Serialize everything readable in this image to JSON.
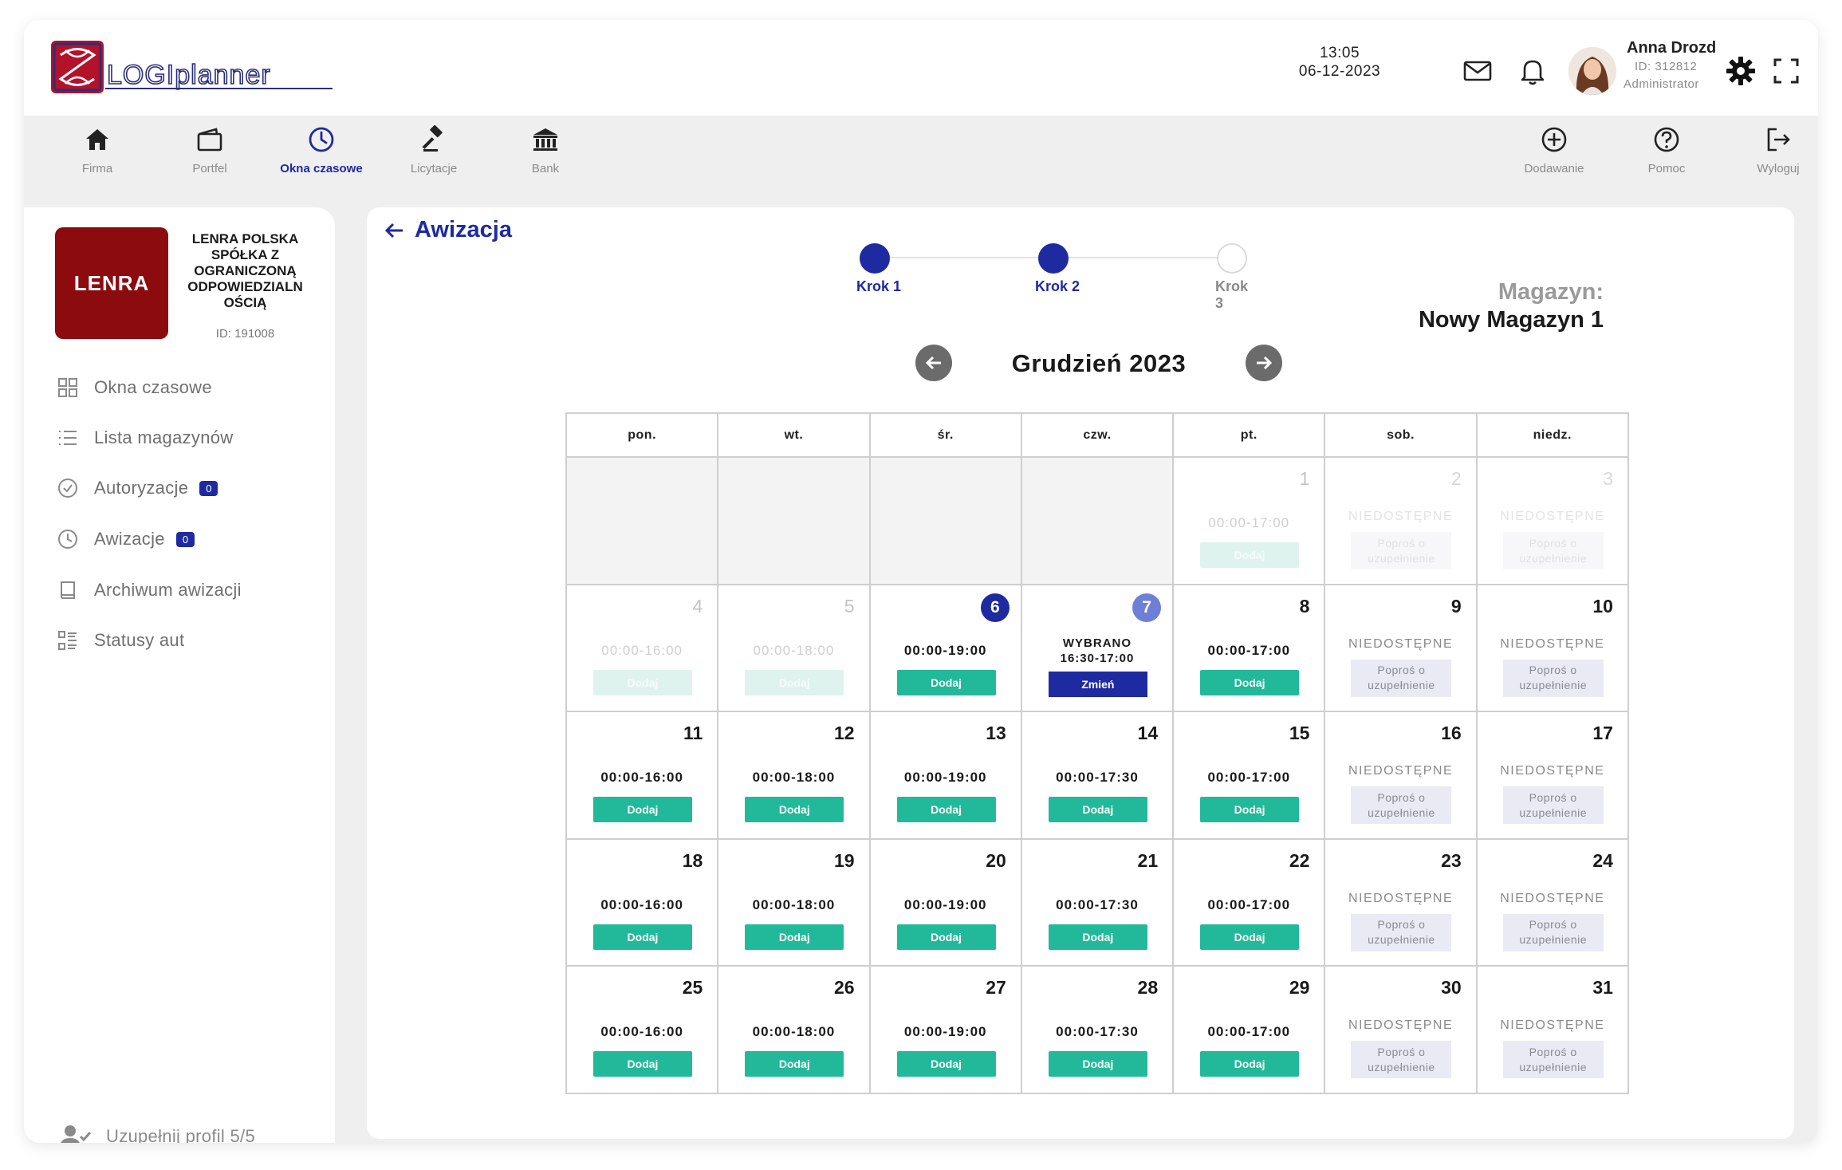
{
  "header": {
    "logo_text": "LOGIplanner",
    "time": "13:05",
    "date": "06-12-2023",
    "user": {
      "name": "Anna Drozd",
      "id": "ID: 312812",
      "role": "Administrator"
    }
  },
  "nav": {
    "left": [
      {
        "label": "Firma",
        "icon": "home-icon"
      },
      {
        "label": "Portfel",
        "icon": "wallet-icon"
      },
      {
        "label": "Okna czasowe",
        "icon": "clock-icon",
        "active": true
      },
      {
        "label": "Licytacje",
        "icon": "gavel-icon"
      },
      {
        "label": "Bank",
        "icon": "bank-icon"
      }
    ],
    "right": [
      {
        "label": "Dodawanie",
        "icon": "plus-circle-icon"
      },
      {
        "label": "Pomoc",
        "icon": "help-icon"
      },
      {
        "label": "Wyloguj",
        "icon": "logout-icon"
      }
    ]
  },
  "sidebar": {
    "company_logo_text": "LENRA",
    "company_name": "LENRA POLSKA SPÓŁKA Z OGRANICZONĄ ODPOWIEDZIALN OŚCIĄ",
    "company_id": "ID: 191008",
    "menu": [
      {
        "label": "Okna czasowe",
        "icon": "grid-icon"
      },
      {
        "label": "Lista magazynów",
        "icon": "list-icon"
      },
      {
        "label": "Autoryzacje",
        "icon": "check-circle-icon",
        "badge": "0"
      },
      {
        "label": "Awizacje",
        "icon": "clock-icon",
        "badge": "0"
      },
      {
        "label": "Archiwum awizacji",
        "icon": "book-icon"
      },
      {
        "label": "Statusy aut",
        "icon": "status-list-icon"
      }
    ],
    "profile": "Uzupełnij profil  5/5"
  },
  "main": {
    "title": "Awizacja",
    "steps": [
      {
        "label": "Krok 1",
        "state": "done"
      },
      {
        "label": "Krok 2",
        "state": "done"
      },
      {
        "label": "Krok 3",
        "state": "todo"
      }
    ],
    "warehouse_label": "Magazyn:",
    "warehouse_name": "Nowy Magazyn 1",
    "month_title": "Grudzień 2023"
  },
  "calendar": {
    "weekdays": [
      "pon.",
      "wt.",
      "śr.",
      "czw.",
      "pt.",
      "sob.",
      "niedz."
    ],
    "add_label": "Dodaj",
    "unavailable_label": "NIEDOSTĘPNE",
    "request_label": "Poproś o uzupełnienie",
    "chosen_label": "WYBRANO",
    "change_label": "Zmień",
    "weeks": [
      [
        {
          "empty": true
        },
        {
          "empty": true
        },
        {
          "empty": true
        },
        {
          "empty": true
        },
        {
          "day": "1",
          "hours": "00:00-17:00",
          "past": true
        },
        {
          "day": "2",
          "unavailable": true,
          "past": true
        },
        {
          "day": "3",
          "unavailable": true,
          "past": true
        }
      ],
      [
        {
          "day": "4",
          "hours": "00:00-16:00",
          "past": true
        },
        {
          "day": "5",
          "hours": "00:00-18:00",
          "past": true
        },
        {
          "day": "6",
          "hours": "00:00-19:00",
          "today": true
        },
        {
          "day": "7",
          "chosen": "16:30-17:00"
        },
        {
          "day": "8",
          "hours": "00:00-17:00"
        },
        {
          "day": "9",
          "unavailable": true
        },
        {
          "day": "10",
          "unavailable": true
        }
      ],
      [
        {
          "day": "11",
          "hours": "00:00-16:00"
        },
        {
          "day": "12",
          "hours": "00:00-18:00"
        },
        {
          "day": "13",
          "hours": "00:00-19:00"
        },
        {
          "day": "14",
          "hours": "00:00-17:30"
        },
        {
          "day": "15",
          "hours": "00:00-17:00"
        },
        {
          "day": "16",
          "unavailable": true
        },
        {
          "day": "17",
          "unavailable": true
        }
      ],
      [
        {
          "day": "18",
          "hours": "00:00-16:00"
        },
        {
          "day": "19",
          "hours": "00:00-18:00"
        },
        {
          "day": "20",
          "hours": "00:00-19:00"
        },
        {
          "day": "21",
          "hours": "00:00-17:30"
        },
        {
          "day": "22",
          "hours": "00:00-17:00"
        },
        {
          "day": "23",
          "unavailable": true
        },
        {
          "day": "24",
          "unavailable": true
        }
      ],
      [
        {
          "day": "25",
          "hours": "00:00-16:00"
        },
        {
          "day": "26",
          "hours": "00:00-18:00"
        },
        {
          "day": "27",
          "hours": "00:00-19:00"
        },
        {
          "day": "28",
          "hours": "00:00-17:30"
        },
        {
          "day": "29",
          "hours": "00:00-17:00"
        },
        {
          "day": "30",
          "unavailable": true
        },
        {
          "day": "31",
          "unavailable": true
        }
      ]
    ]
  },
  "colors": {
    "brand_blue": "#1e2aa0",
    "add_green": "#22b99a",
    "chosen_day": "#6e7fd6",
    "company_red": "#8b0b0f"
  }
}
